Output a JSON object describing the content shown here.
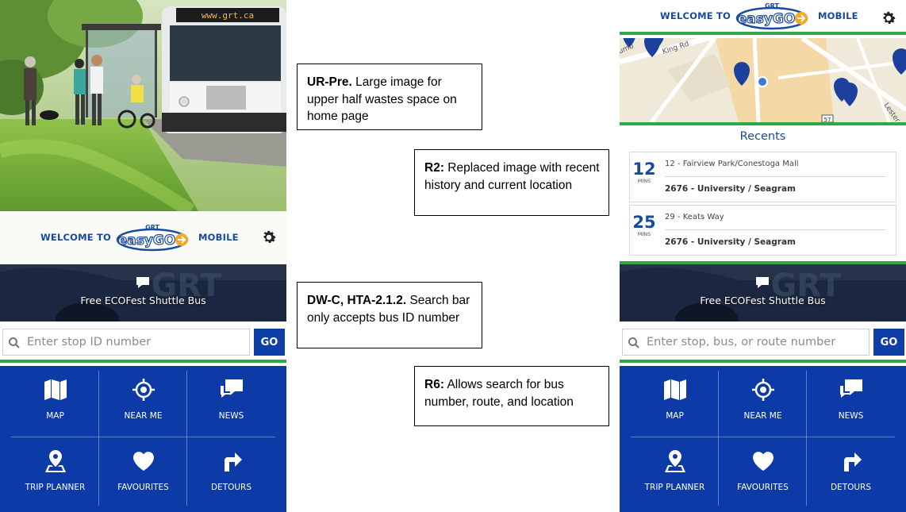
{
  "colors": {
    "brand_blue": "#0c3aa6",
    "accent_green": "#2fa84a",
    "text_blue": "#1a4a9e",
    "logo_orange": "#f7a823"
  },
  "logo": {
    "top_text": "GRT",
    "text": "easyGO"
  },
  "left_phone": {
    "bus_destination": "www.grt.ca",
    "welcome_prefix": "WELCOME TO",
    "welcome_suffix": "MOBILE",
    "banner_text": "Free ECOFest Shuttle Bus",
    "search_placeholder": "Enter stop ID number",
    "go_label": "GO",
    "menu": [
      {
        "label": "MAP",
        "icon": "map-icon"
      },
      {
        "label": "NEAR ME",
        "icon": "crosshair-icon"
      },
      {
        "label": "NEWS",
        "icon": "chat-bubbles-icon"
      },
      {
        "label": "TRIP PLANNER",
        "icon": "map-pin-icon"
      },
      {
        "label": "FAVOURITES",
        "icon": "heart-icon"
      },
      {
        "label": "DETOURS",
        "icon": "turn-right-icon"
      }
    ]
  },
  "right_phone": {
    "welcome_prefix": "WELCOME TO",
    "welcome_suffix": "MOBILE",
    "map_labels": {
      "road1": "King Rd",
      "road2": "Lester",
      "road3": "umb",
      "shield": "57"
    },
    "recents_title": "Recents",
    "recents": [
      {
        "mins": "12",
        "unit": "MINS",
        "route": "12 - Fairview Park/Conestoga Mall",
        "stop": "2676 - University / Seagram"
      },
      {
        "mins": "25",
        "unit": "MINS",
        "route": "29 - Keats Way",
        "stop": "2676 - University / Seagram"
      }
    ],
    "banner_text": "Free ECOFest Shuttle Bus",
    "search_placeholder": "Enter stop, bus, or route number",
    "go_label": "GO",
    "menu": [
      {
        "label": "MAP",
        "icon": "map-icon"
      },
      {
        "label": "NEAR ME",
        "icon": "crosshair-icon"
      },
      {
        "label": "NEWS",
        "icon": "chat-bubbles-icon"
      },
      {
        "label": "TRIP PLANNER",
        "icon": "map-pin-icon"
      },
      {
        "label": "FAVOURITES",
        "icon": "heart-icon"
      },
      {
        "label": "DETOURS",
        "icon": "turn-right-icon"
      }
    ]
  },
  "annotations": [
    {
      "tag": "UR-Pre.",
      "text": "Large image for upper half wastes space on home page"
    },
    {
      "tag": "R2:",
      "text": "Replaced image with recent history and current location"
    },
    {
      "tag": "DW-C, HTA-2.1.2.",
      "text": "Search bar only accepts bus ID number"
    },
    {
      "tag": "R6:",
      "text": "Allows search for bus number, route, and location"
    }
  ]
}
